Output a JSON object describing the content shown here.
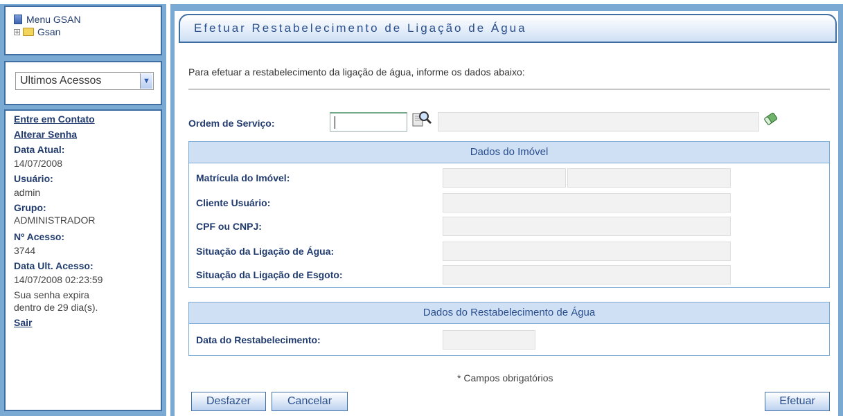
{
  "sidebar": {
    "menu_title": "Menu GSAN",
    "tree_root": "Gsan",
    "recent_select": "Ultimos Acessos",
    "links": {
      "contato": "Entre em Contato",
      "senha": "Alterar Senha",
      "sair": "Sair"
    },
    "info": {
      "data_atual_label": "Data Atual:",
      "data_atual": "14/07/2008",
      "usuario_label": "Usuário:",
      "usuario": "admin",
      "grupo_label": "Grupo:",
      "grupo": "ADMINISTRADOR",
      "acesso_label": "Nº Acesso:",
      "acesso": "3744",
      "ult_acesso_label": "Data Ult. Acesso:",
      "ult_acesso": "14/07/2008 02:23:59",
      "expira_1": "Sua senha expira",
      "expira_2": "dentro de 29 dia(s)."
    }
  },
  "main": {
    "title": "Efetuar Restabelecimento de Ligação de Água",
    "instructions": "Para efetuar a restabelecimento da ligação de água, informe os dados abaixo:",
    "ordem_servico_label": "Ordem de Serviço:",
    "ordem_servico_value": "",
    "imovel_section": {
      "header": "Dados do Imóvel",
      "matricula_label": "Matrícula do Imóvel:",
      "cliente_label": "Cliente Usuário:",
      "cpf_label": "CPF ou CNPJ:",
      "sit_agua_label": "Situação da Ligação de Água:",
      "sit_esgoto_label": "Situação da Ligação de Esgoto:"
    },
    "restab_section": {
      "header": "Dados do Restabelecimento de Água",
      "data_label": "Data do Restabelecimento:"
    },
    "required_note": "* Campos obrigatórios",
    "buttons": {
      "desfazer": "Desfazer",
      "cancelar": "Cancelar",
      "efetuar": "Efetuar"
    }
  },
  "icons": {
    "menu": "menu-icon",
    "folder": "folder-icon",
    "search": "search-icon",
    "eraser": "eraser-icon"
  },
  "colors": {
    "frame_blue": "#7aa9d4",
    "border_blue": "#3f6ea3",
    "header_blue": "#cfe0f5",
    "text_navy": "#213b6e"
  }
}
